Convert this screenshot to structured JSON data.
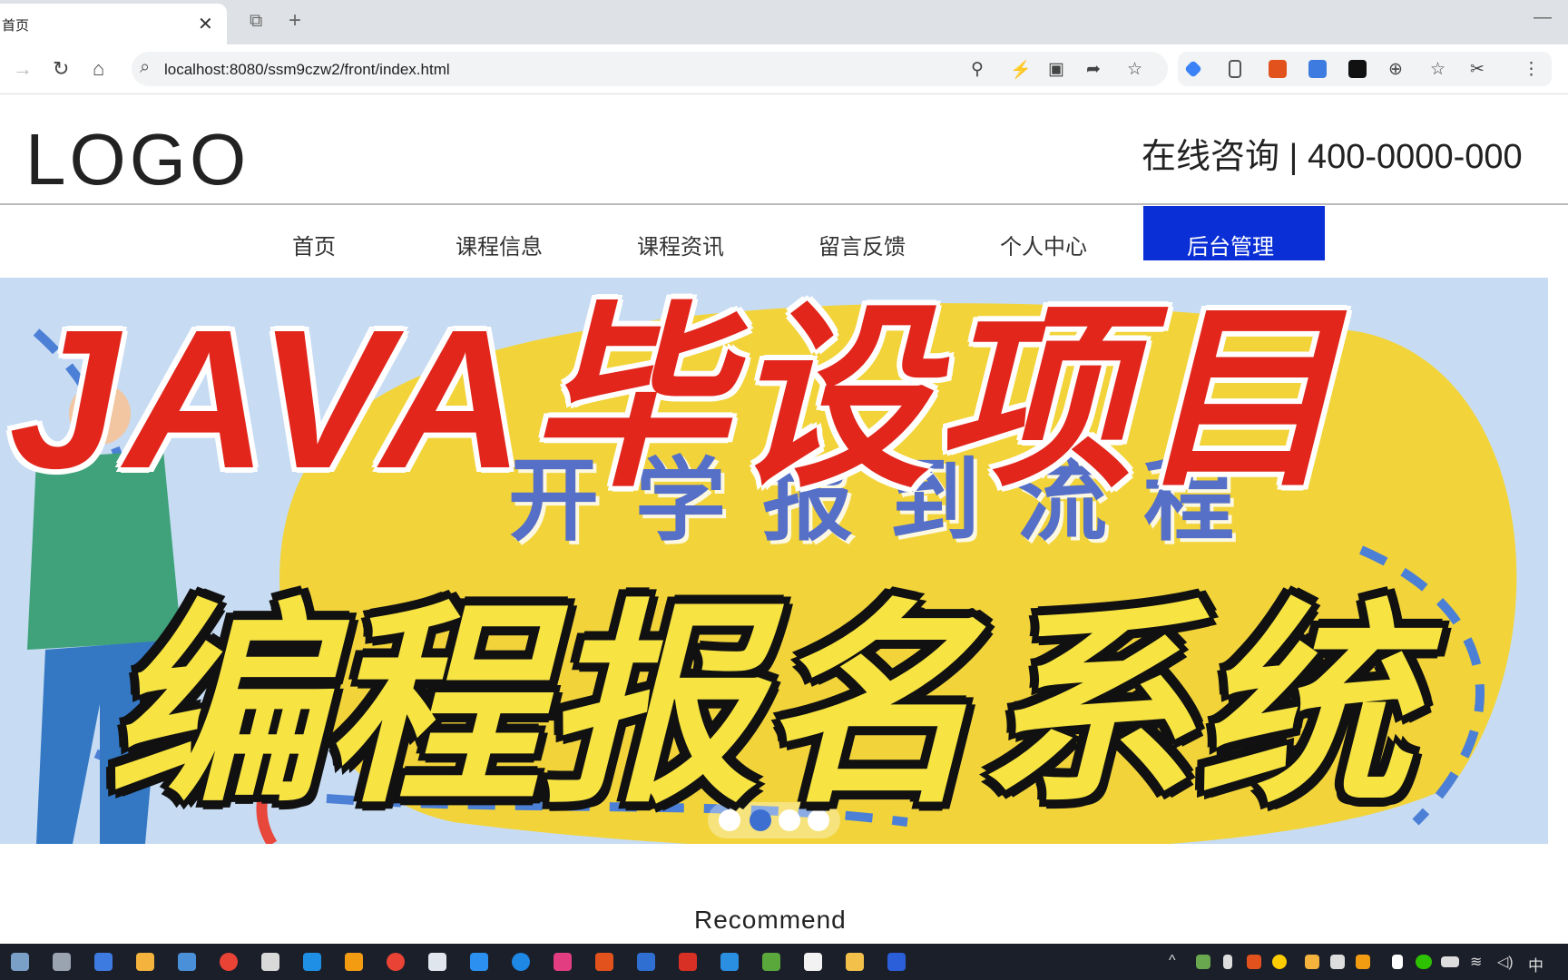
{
  "browser": {
    "tab_title": "首页",
    "tab_close": "✕",
    "new_tab": "+",
    "minimize": "—",
    "url": "localhost:8080/ssm9czw2/front/index.html"
  },
  "site": {
    "logo": "LOGO",
    "consult": "在线咨询 | 400-0000-000",
    "nav": [
      "首页",
      "课程信息",
      "课程资讯",
      "留言反馈",
      "个人中心"
    ],
    "admin_label": "后台管理"
  },
  "banner": {
    "title": "JAVA毕设项目",
    "subtitle": "编程报名系统",
    "bg_text": "开学报到流程",
    "slide_count": 4,
    "active_slide": 2
  },
  "section": {
    "recommend": "Recommend"
  },
  "colors": {
    "title_red": "#e2261c",
    "subtitle_yellow": "#f7e442",
    "admin_blue": "#0a2fd6",
    "banner_yellow": "#f2d43a"
  },
  "taskbar": {
    "ime": "中"
  }
}
